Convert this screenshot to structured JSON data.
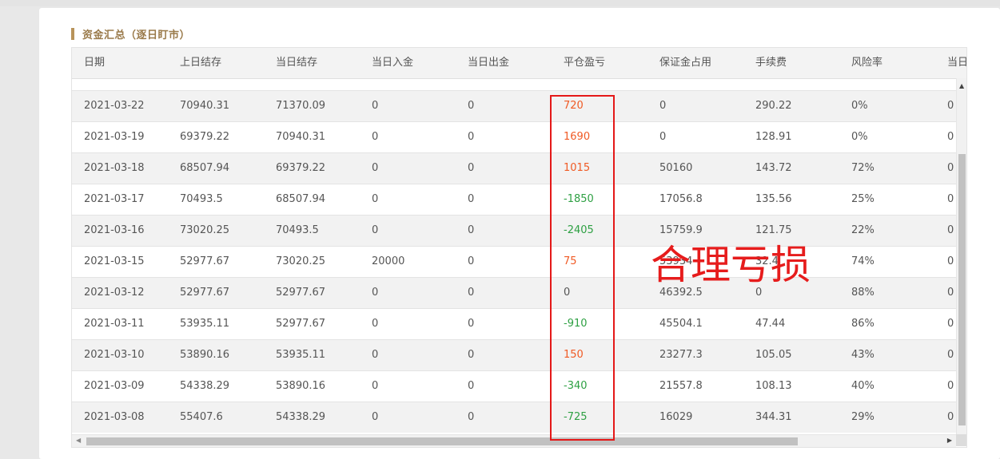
{
  "section": {
    "title": "资金汇总（逐日盯市）"
  },
  "table": {
    "columns": [
      "日期",
      "上日结存",
      "当日结存",
      "当日入金",
      "当日出金",
      "平仓盈亏",
      "保证金占用",
      "手续费",
      "风险率",
      "当日"
    ],
    "rows": [
      {
        "date": "2021-03-22",
        "prev": "70940.31",
        "curr": "71370.09",
        "in": "0",
        "out": "0",
        "pnl": "720",
        "pnl_sign": "pos",
        "margin": "0",
        "fee": "290.22",
        "risk": "0%",
        "last": "0"
      },
      {
        "date": "2021-03-19",
        "prev": "69379.22",
        "curr": "70940.31",
        "in": "0",
        "out": "0",
        "pnl": "1690",
        "pnl_sign": "pos",
        "margin": "0",
        "fee": "128.91",
        "risk": "0%",
        "last": "0"
      },
      {
        "date": "2021-03-18",
        "prev": "68507.94",
        "curr": "69379.22",
        "in": "0",
        "out": "0",
        "pnl": "1015",
        "pnl_sign": "pos",
        "margin": "50160",
        "fee": "143.72",
        "risk": "72%",
        "last": "0"
      },
      {
        "date": "2021-03-17",
        "prev": "70493.5",
        "curr": "68507.94",
        "in": "0",
        "out": "0",
        "pnl": "-1850",
        "pnl_sign": "neg",
        "margin": "17056.8",
        "fee": "135.56",
        "risk": "25%",
        "last": "0"
      },
      {
        "date": "2021-03-16",
        "prev": "73020.25",
        "curr": "70493.5",
        "in": "0",
        "out": "0",
        "pnl": "-2405",
        "pnl_sign": "neg",
        "margin": "15759.9",
        "fee": "121.75",
        "risk": "22%",
        "last": "0"
      },
      {
        "date": "2021-03-15",
        "prev": "52977.67",
        "curr": "73020.25",
        "in": "20000",
        "out": "0",
        "pnl": "75",
        "pnl_sign": "pos",
        "margin": "53934",
        "fee": "32.4",
        "risk": "74%",
        "last": "0"
      },
      {
        "date": "2021-03-12",
        "prev": "52977.67",
        "curr": "52977.67",
        "in": "0",
        "out": "0",
        "pnl": "0",
        "pnl_sign": "zero",
        "margin": "46392.5",
        "fee": "0",
        "risk": "88%",
        "last": "0"
      },
      {
        "date": "2021-03-11",
        "prev": "53935.11",
        "curr": "52977.67",
        "in": "0",
        "out": "0",
        "pnl": "-910",
        "pnl_sign": "neg",
        "margin": "45504.1",
        "fee": "47.44",
        "risk": "86%",
        "last": "0"
      },
      {
        "date": "2021-03-10",
        "prev": "53890.16",
        "curr": "53935.11",
        "in": "0",
        "out": "0",
        "pnl": "150",
        "pnl_sign": "pos",
        "margin": "23277.3",
        "fee": "105.05",
        "risk": "43%",
        "last": "0"
      },
      {
        "date": "2021-03-09",
        "prev": "54338.29",
        "curr": "53890.16",
        "in": "0",
        "out": "0",
        "pnl": "-340",
        "pnl_sign": "neg",
        "margin": "21557.8",
        "fee": "108.13",
        "risk": "40%",
        "last": "0"
      },
      {
        "date": "2021-03-08",
        "prev": "55407.6",
        "curr": "54338.29",
        "in": "0",
        "out": "0",
        "pnl": "-725",
        "pnl_sign": "neg",
        "margin": "16029",
        "fee": "344.31",
        "risk": "29%",
        "last": "0"
      }
    ]
  },
  "annotation": {
    "text": "合理亏损",
    "color": "#e61c1c"
  },
  "colors": {
    "positive": "#f05a24",
    "negative": "#2ea043",
    "accent": "#b8935a",
    "highlight": "#e41818"
  }
}
